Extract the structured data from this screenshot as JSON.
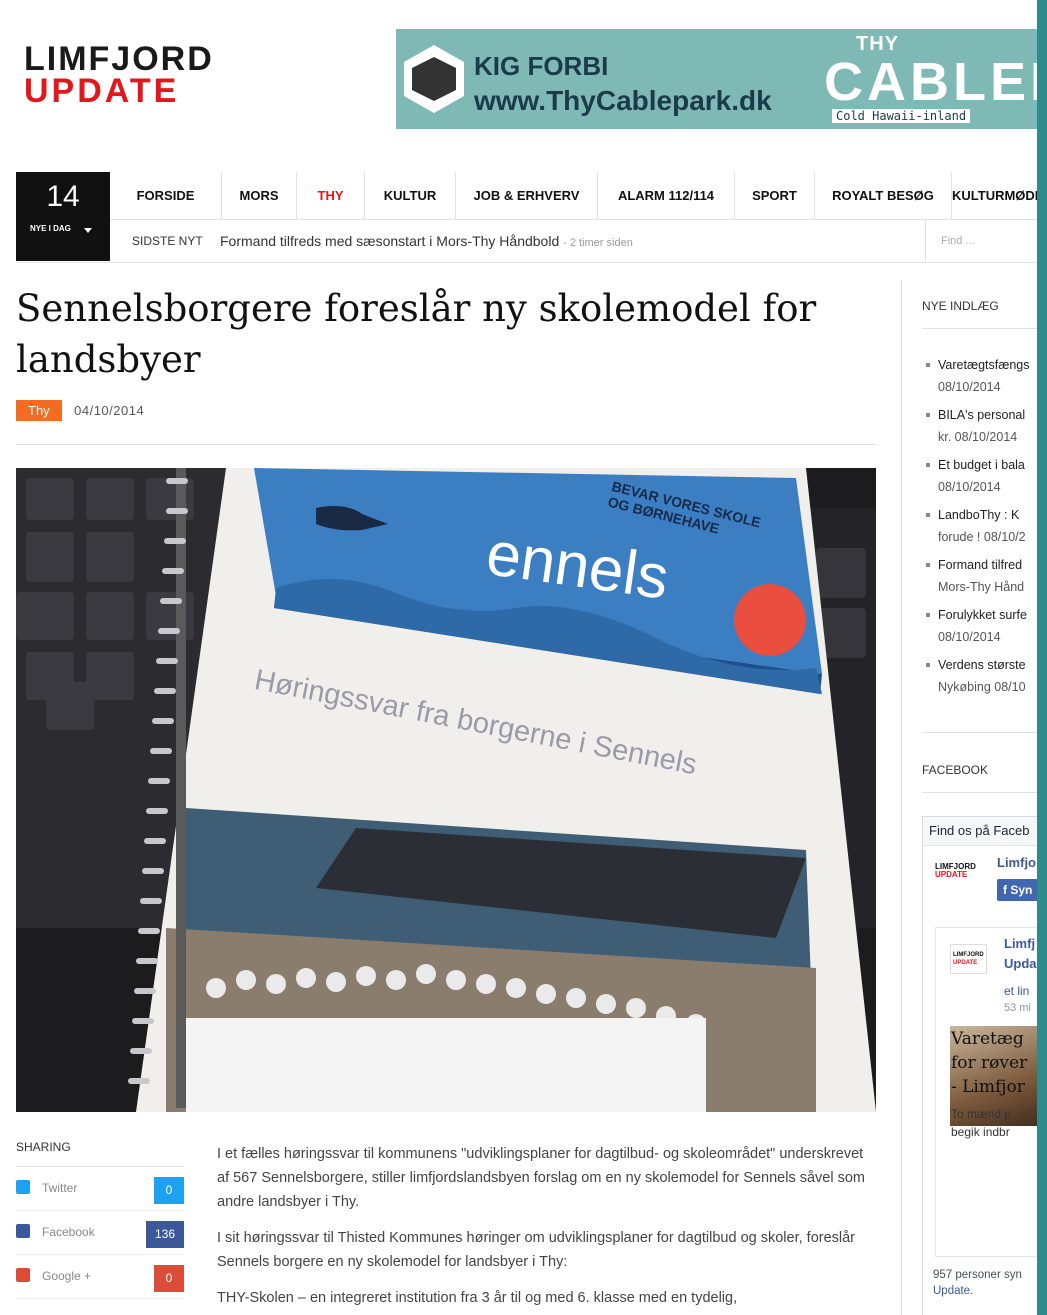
{
  "site": {
    "logo_line1": "LIMFJORD",
    "logo_line2": "UPDATE"
  },
  "banner": {
    "line1": "KIG FORBI",
    "line2": "www.ThyCablepark.dk",
    "brand_small": "THY",
    "brand": "CABLEP",
    "tagline": "Cold Hawaii-inland"
  },
  "date_box": {
    "day": "14",
    "label": "NYE I DAG"
  },
  "nav": {
    "items": [
      "FORSIDE",
      "MORS",
      "THY",
      "KULTUR",
      "JOB & ERHVERV",
      "ALARM 112/114",
      "SPORT",
      "ROYALT BESØG",
      "KULTURMØDE"
    ],
    "active": "THY"
  },
  "ticker": {
    "label": "SIDSTE NYT",
    "headline": "Formand tilfreds med sæsonstart i Mors-Thy Håndbold",
    "ago": "- 2 timer siden",
    "search_placeholder": "Find ..."
  },
  "article": {
    "title": "Sennelsborgere foreslår ny skolemodel for landsbyer",
    "category": "Thy",
    "date": "04/10/2014",
    "paragraphs": [
      "I et fælles høringssvar til kommunens \"udviklingsplaner for dagtilbud- og skoleområdet\" underskrevet af 567 Sennelsborgere, stiller limfjordslandsbyen forslag om en ny skolemodel for Sennels såvel som andre landsbyer i Thy.",
      "I sit høringssvar til Thisted Kommunes høringer om udviklingsplaner for dagtilbud og skoler, foreslår Sennels borgere en ny skolemodel for landsbyer i Thy:",
      "THY-Skolen – en integreret institution fra 3 år til og med 6. klasse med en tydelig,"
    ]
  },
  "photo": {
    "title": "Høringssvar fra borgerne i Sennels",
    "brand": "ennels",
    "slogan_1": "BEVAR VORES SKOLE",
    "slogan_2": "OG BØRNEHAVE"
  },
  "sharing": {
    "heading": "SHARING",
    "items": [
      {
        "name": "Twitter",
        "count": "0",
        "icon": "twitter-icon",
        "color": "#1da1f2"
      },
      {
        "name": "Facebook",
        "count": "136",
        "icon": "facebook-icon",
        "color": "#3b5998"
      },
      {
        "name": "Google +",
        "count": "0",
        "icon": "google-plus-icon",
        "color": "#dd4b39"
      }
    ]
  },
  "sidebar": {
    "recent_heading": "NYE INDLÆG",
    "posts": [
      {
        "line1": "Varetægtsfængs",
        "line2": "08/10/2014"
      },
      {
        "line1": "BILA's personal",
        "line2": "kr. 08/10/2014"
      },
      {
        "line1": "Et budget i bala",
        "line2": "08/10/2014"
      },
      {
        "line1": "LandboThy : K",
        "line2": "forude ! 08/10/2"
      },
      {
        "line1": "Formand tilfred",
        "line2": "Mors-Thy Hånd"
      },
      {
        "line1": "Forulykket surfe",
        "line2": "08/10/2014"
      },
      {
        "line1": "Verdens største",
        "line2": "Nykøbing 08/10"
      }
    ],
    "facebook_heading": "FACEBOOK",
    "fb": {
      "header": "Find os på Faceb",
      "page_name": "Limfjo",
      "follow": "Syn",
      "card_name_1": "Limfj",
      "card_name_2": "Upda",
      "card_link": "et lin",
      "card_time": "53 mi",
      "post_title_1": "Varetæg",
      "post_title_2": "for røver",
      "post_title_3": "- Limfjor",
      "post_desc_1": "To mænd p",
      "post_desc_2": "begik indbr",
      "likes": "957 personer syn",
      "likes_link": "Update."
    }
  }
}
